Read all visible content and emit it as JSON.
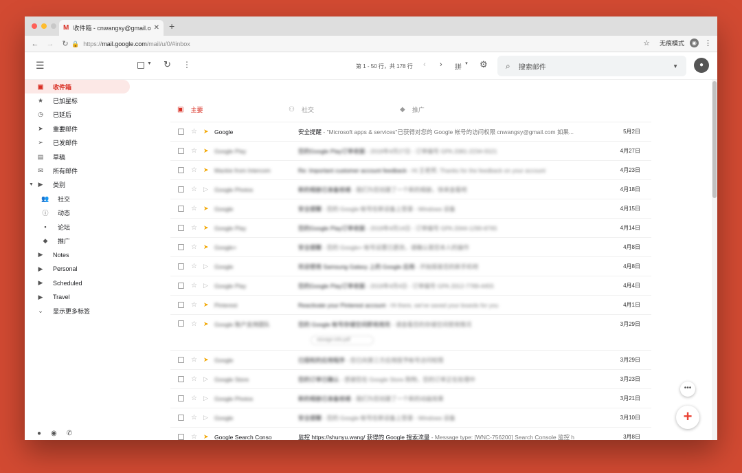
{
  "browser": {
    "tab_title": "收件箱 - cnwangsy@gmail.com",
    "tab_icon": "gmail-m-icon",
    "new_tab": "+",
    "url_scheme": "https://",
    "url_host": "mail.google.com",
    "url_path": "/mail/u/0/#inbox",
    "incognito_label": "无痕模式"
  },
  "toolbar": {
    "pagination": "第 1 - 50 行，共 178 行",
    "input_tool": "拼",
    "search_placeholder": "搜索邮件"
  },
  "sidebar": {
    "items": [
      {
        "label": "收件箱",
        "icon": "inbox-icon",
        "glyph": "▣"
      },
      {
        "label": "已加星标",
        "icon": "star-icon",
        "glyph": "★"
      },
      {
        "label": "已延后",
        "icon": "clock-icon",
        "glyph": "◷"
      },
      {
        "label": "重要邮件",
        "icon": "important-icon",
        "glyph": "➤"
      },
      {
        "label": "已发邮件",
        "icon": "send-icon",
        "glyph": "➢"
      },
      {
        "label": "草稿",
        "icon": "draft-icon",
        "glyph": "▤"
      },
      {
        "label": "所有邮件",
        "icon": "mail-icon",
        "glyph": "✉"
      },
      {
        "label": "类别",
        "icon": "label-icon",
        "glyph": "▶"
      },
      {
        "label": "社交",
        "icon": "people-icon",
        "glyph": "👥"
      },
      {
        "label": "动态",
        "icon": "info-icon",
        "glyph": "ⓘ"
      },
      {
        "label": "论坛",
        "icon": "forum-icon",
        "glyph": "▪"
      },
      {
        "label": "推广",
        "icon": "tag-icon",
        "glyph": "◆"
      },
      {
        "label": "Notes",
        "icon": "label-icon",
        "glyph": "▶"
      },
      {
        "label": "Personal",
        "icon": "label-icon",
        "glyph": "▶"
      },
      {
        "label": "Scheduled",
        "icon": "label-icon",
        "glyph": "▶"
      },
      {
        "label": "Travel",
        "icon": "label-icon",
        "glyph": "▶"
      },
      {
        "label": "显示更多标签",
        "icon": "chevron-down-icon",
        "glyph": "⌄"
      }
    ]
  },
  "category_tabs": [
    {
      "label": "主要",
      "icon": "inbox-icon"
    },
    {
      "label": "社交",
      "icon": "people-icon"
    },
    {
      "label": "推广",
      "icon": "tag-icon"
    }
  ],
  "emails": [
    {
      "sender": "Google",
      "subject": "安全提醒",
      "snippet": " - \"Microsoft apps & services\"已获得对您的 Google 帐号的访问权限 cnwangsy@gmail.com 如果...",
      "date": "5月2日",
      "important": true,
      "blurred": false
    },
    {
      "sender": "Google Play",
      "subject": "您的Google Play订单收据",
      "snippet": " - 2019年4月27日 - 订单编号 GPA.3381-2234-5521",
      "date": "4月27日",
      "important": true,
      "blurred": true
    },
    {
      "sender": "Mackie from Intercom",
      "subject": "Re: Important customer account feedback",
      "snippet": " - Hi 王老师, Thanks for the feedback on your account",
      "date": "4月23日",
      "important": true,
      "blurred": true
    },
    {
      "sender": "Google Photos",
      "subject": "新的相册已准备就绪",
      "snippet": " - 我们为您创建了一个新的相册，快来查看吧",
      "date": "4月18日",
      "important": false,
      "blurred": true
    },
    {
      "sender": "Google",
      "subject": "安全提醒",
      "snippet": " - 您的 Google 帐号在新设备上登录 - Windows 设备",
      "date": "4月15日",
      "important": true,
      "blurred": true
    },
    {
      "sender": "Google Play",
      "subject": "您的Google Play订单收据",
      "snippet": " - 2019年4月14日 - 订单编号 GPA.3344-1290-8765",
      "date": "4月14日",
      "important": true,
      "blurred": true
    },
    {
      "sender": "Google+",
      "subject": "安全提醒",
      "snippet": " - 您的 Google+ 帐号设置已更改，请确认是您本人的操作",
      "date": "4月8日",
      "important": true,
      "blurred": true
    },
    {
      "sender": "Google",
      "subject": "欢迎使用 Samsung Galaxy 上的 Google 应用",
      "snippet": " - 开始探索您的新手机吧",
      "date": "4月8日",
      "important": false,
      "blurred": true
    },
    {
      "sender": "Google Play",
      "subject": "您的Google Play订单收据",
      "snippet": " - 2019年4月4日 - 订单编号 GPA.3312-7789-4455",
      "date": "4月4日",
      "important": false,
      "blurred": true
    },
    {
      "sender": "Pinterest",
      "subject": "Reactivate your Pinterest account",
      "snippet": " - Hi there, we've saved your boards for you",
      "date": "4月1日",
      "important": true,
      "blurred": true
    },
    {
      "sender": "Google 账户支持团队",
      "subject": "您的 Google 帐号存储空间即将用完",
      "snippet": " - 请查看您的存储空间使用情况",
      "date": "3月29日",
      "important": true,
      "blurred": true,
      "attachment": "storage-info.pdf"
    },
    {
      "sender": "Google",
      "subject": "已授权的应用程序",
      "snippet": " - 您已向第三方应用授予帐号访问权限",
      "date": "3月29日",
      "important": true,
      "blurred": true
    },
    {
      "sender": "Google Store",
      "subject": "您的订单已确认",
      "snippet": " - 感谢您在 Google Store 购物，您的订单正在处理中",
      "date": "3月23日",
      "important": false,
      "blurred": true
    },
    {
      "sender": "Google Photos",
      "subject": "新的相册已准备就绪",
      "snippet": " - 我们为您创建了一个新的动画效果",
      "date": "3月21日",
      "important": false,
      "blurred": true
    },
    {
      "sender": "Google",
      "subject": "安全提醒",
      "snippet": " - 您的 Google 帐号在新设备上登录 - Windows 设备",
      "date": "3月10日",
      "important": false,
      "blurred": true
    },
    {
      "sender": "Google Search Conso",
      "subject": "监控 https://shunyu.wang/ 获得的 Google 搜索流量",
      "snippet": " - Message type: [WNC-756200] Search Console 监控 h",
      "date": "3月8日",
      "important": true,
      "blurred": false
    }
  ],
  "fab": {
    "more": "•••",
    "compose": "+"
  },
  "colors": {
    "accent": "#d93025",
    "important": "#f2a600",
    "background": "#d24a32"
  }
}
